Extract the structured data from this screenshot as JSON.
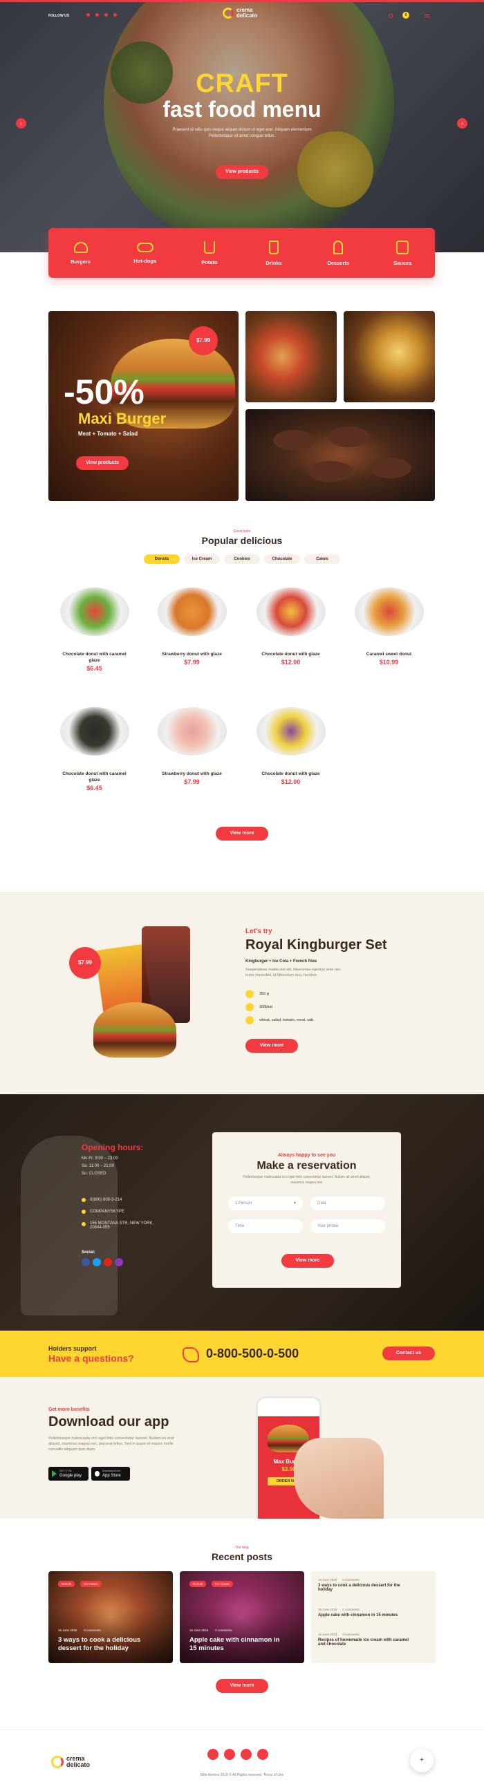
{
  "header": {
    "follow_label": "FOLLOW US",
    "logo_line1": "crema",
    "logo_line2": "delicato",
    "cart_count": "0"
  },
  "hero": {
    "title_line1": "CRAFT",
    "title_line2": "fast food menu",
    "text_line1": "Praesent id odio quis neque aliquet dictum ut eget erat. Aliquam elementum",
    "text_line2": "Pellentesque sit amet congue tellus.",
    "button": "View products"
  },
  "categories": [
    {
      "label": "Burgers",
      "icon": "burger-icon"
    },
    {
      "label": "Hot-dogs",
      "icon": "hotdog-icon"
    },
    {
      "label": "Potato",
      "icon": "fries-icon"
    },
    {
      "label": "Drinks",
      "icon": "drink-icon"
    },
    {
      "label": "Desserts",
      "icon": "icecream-icon"
    },
    {
      "label": "Sauces",
      "icon": "sauce-icon"
    }
  ],
  "promo": {
    "price": "$7.99",
    "discount": "-50%",
    "title": "Maxi Burger",
    "subtitle": "Meat + Tomato + Salad",
    "button": "View products"
  },
  "popular": {
    "kicker": "Great taste",
    "title": "Popular delicious",
    "tabs": [
      "Donuts",
      "Ice Cream",
      "Cookies",
      "Chocolate",
      "Cakes"
    ],
    "items": [
      {
        "name": "Chocolate donut with caramel glaze",
        "price": "$6.45"
      },
      {
        "name": "Strawberry donut with glaze",
        "price": "$7.99"
      },
      {
        "name": "Chocolate donut with glaze",
        "price": "$12.00"
      },
      {
        "name": "Caramel sweet donut",
        "price": "$10.99"
      },
      {
        "name": "Chocolate donut with caramel glaze",
        "price": "$6.45"
      },
      {
        "name": "Strawberry donut with glaze",
        "price": "$7.99"
      },
      {
        "name": "Chocolate donut with glaze",
        "price": "$12.00"
      }
    ],
    "button": "View more"
  },
  "kingburger": {
    "kicker": "Let's try",
    "title": "Royal Kingburger Set",
    "price": "$7.99",
    "combo": "Kingburger + Ice Cola + French fries",
    "desc_line1": "Suspendisse mattis nisl elit. Maecenas egestas ante nec",
    "desc_line2": "tortor imperdiet, id bibendum arcu hendrer.",
    "spec1": "350 g",
    "spec2": "300kkal",
    "spec3": "wheat, salad, tomato, meat, salt,",
    "button": "View more"
  },
  "reservation": {
    "hours_title": "Opening hours:",
    "hours": [
      "Mo-Fr: 9:00 – 23:00",
      "Sa: 11:00 – 21:00",
      "Su: CLOSED"
    ],
    "phone": "0(800) 809-3-214",
    "skype": "COMPANYSKYPE",
    "address_line1": "155 MONTANA STR, NEW YORK,",
    "address_line2": "20844-055",
    "social_label": "Social:",
    "form_kicker": "Always happy to see you",
    "form_title": "Make a reservation",
    "form_text_line1": "Pellentesque malesuada orci eget felis consectetur laoreet. Nullam sit amet aliquet,",
    "form_text_line2": "maximus magna nec",
    "persons_value": "1 Person",
    "date_placeholder": "Date",
    "time_placeholder": "Time",
    "phone_placeholder": "Your phone",
    "button": "View more"
  },
  "support": {
    "kicker": "Holders support",
    "title": "Have a questions?",
    "phone": "0-800-500-0-500",
    "button": "Contact us"
  },
  "app": {
    "kicker": "Get more benefits",
    "title": "Download our app",
    "text_line1": "Pellentesque malesuada orci eget felis consectetur laoreet. Nullam eu erat",
    "text_line2": "aliquet, maximus magna nec, placerat tellus. Sed in quam et mauris mollis",
    "text_line3": "convallis aliquam quis diam.",
    "google_small": "GET IT ON",
    "google_label": "Google play",
    "apple_small": "Download on the",
    "apple_label": "App Store",
    "phone_title": "Max Burger",
    "phone_price": "$3.50",
    "phone_button": "ORDER NOW"
  },
  "posts": {
    "kicker": "Our blog",
    "title": "Recent posts",
    "cards": [
      {
        "tags": [
          "Donuts",
          "Ice Cream"
        ],
        "date": "16 June 2018",
        "comments": "0 comments",
        "title_line1": "3 ways to cook a delicious",
        "title_line2": "dessert for the holiday"
      },
      {
        "tags": [
          "Donuts",
          "Ice Cream"
        ],
        "date": "16 June 2018",
        "comments": "0 comments",
        "title_line1": "Apple cake with cinnamon in",
        "title_line2": "15 minutes"
      }
    ],
    "list": [
      {
        "date": "16 June 2018",
        "comments": "0 comments",
        "title_line1": "3 ways to cook a delicious dessert for the",
        "title_line2": "holiday"
      },
      {
        "date": "16 June 2018",
        "comments": "0 comments",
        "title_line1": "Apple cake with cinnamon in 15 minutes",
        "title_line2": ""
      },
      {
        "date": "16 June 2018",
        "comments": "0 comments",
        "title_line1": "Recipes of homemade ice cream with caramel",
        "title_line2": "and chocolate"
      }
    ],
    "button": "View more"
  },
  "footer": {
    "logo_line1": "crema",
    "logo_line2": "delicato",
    "copyright": "Elite themes 2018 © All Rights reserved. Terms of Use"
  },
  "colors": {
    "red": "#f23b41",
    "yellow": "#ffd630",
    "dark": "#3a2a1e",
    "cream": "#f8f3ea"
  }
}
